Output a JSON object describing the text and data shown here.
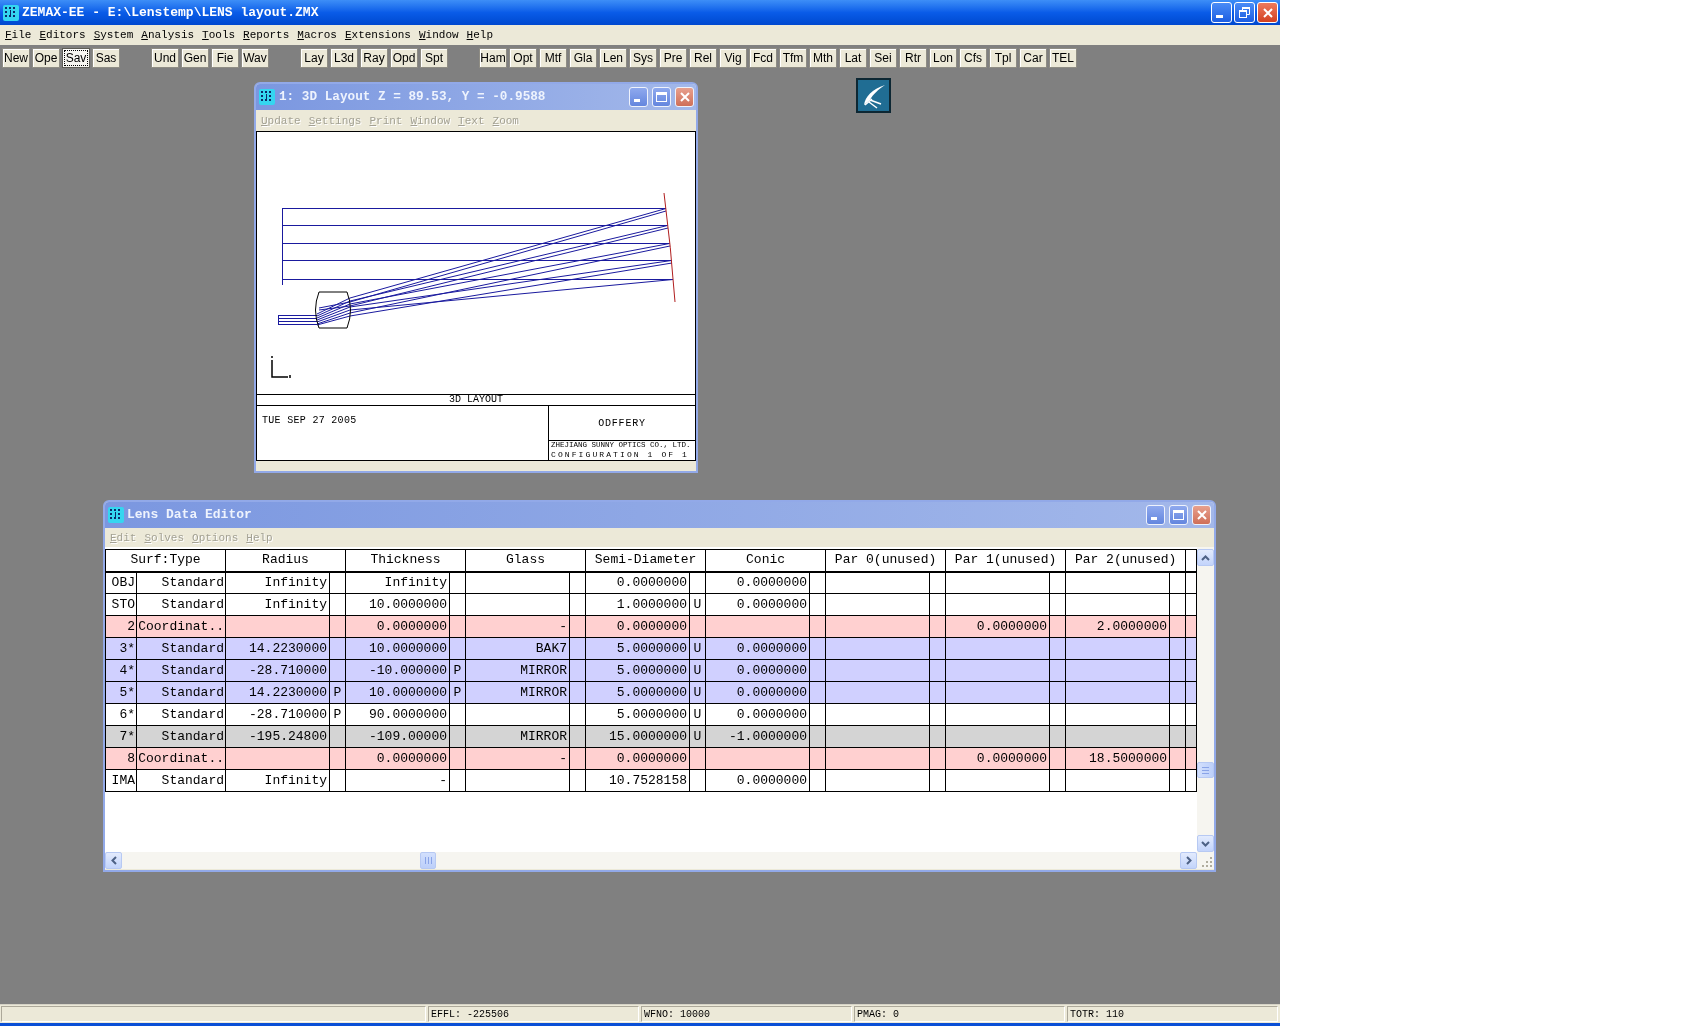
{
  "window": {
    "title": "ZEMAX-EE - E:\\Lenstemp\\LENS layout.ZMX"
  },
  "menu": [
    {
      "label": "File",
      "disabled": false
    },
    {
      "label": "Editors",
      "disabled": false
    },
    {
      "label": "System",
      "disabled": false
    },
    {
      "label": "Analysis",
      "disabled": false
    },
    {
      "label": "Tools",
      "disabled": false
    },
    {
      "label": "Reports",
      "disabled": false
    },
    {
      "label": "Macros",
      "disabled": false
    },
    {
      "label": "Extensions",
      "disabled": false
    },
    {
      "label": "Window",
      "disabled": false
    },
    {
      "label": "Help",
      "disabled": false
    }
  ],
  "toolbar": [
    [
      {
        "label": "New",
        "focused": false
      },
      {
        "label": "Ope",
        "focused": false
      },
      {
        "label": "Sav",
        "focused": true
      },
      {
        "label": "Sas",
        "focused": false
      }
    ],
    [
      {
        "label": "Und",
        "focused": false
      },
      {
        "label": "Gen",
        "focused": false
      },
      {
        "label": "Fie",
        "focused": false
      },
      {
        "label": "Wav",
        "focused": false
      }
    ],
    [
      {
        "label": "Lay",
        "focused": false
      },
      {
        "label": "L3d",
        "focused": false
      },
      {
        "label": "Ray",
        "focused": false
      },
      {
        "label": "Opd",
        "focused": false
      },
      {
        "label": "Spt",
        "focused": false
      }
    ],
    [
      {
        "label": "Ham",
        "focused": false
      },
      {
        "label": "Opt",
        "focused": false
      },
      {
        "label": "Mtf",
        "focused": false
      },
      {
        "label": "Gla",
        "focused": false
      },
      {
        "label": "Len",
        "focused": false
      },
      {
        "label": "Sys",
        "focused": false
      },
      {
        "label": "Pre",
        "focused": false
      },
      {
        "label": "Rel",
        "focused": false
      },
      {
        "label": "Vig",
        "focused": false
      },
      {
        "label": "Fcd",
        "focused": false
      },
      {
        "label": "Tfm",
        "focused": false
      },
      {
        "label": "Mth",
        "focused": false
      },
      {
        "label": "Lat",
        "focused": false
      },
      {
        "label": "Sei",
        "focused": false
      },
      {
        "label": "Rtr",
        "focused": false
      },
      {
        "label": "Lon",
        "focused": false
      },
      {
        "label": "Cfs",
        "focused": false
      },
      {
        "label": "Tpl",
        "focused": false
      },
      {
        "label": "Car",
        "focused": false
      },
      {
        "label": "TEL",
        "focused": false
      }
    ]
  ],
  "layout_window": {
    "title": "1: 3D Layout Z = 89.53, Y = -0.9588",
    "menu": [
      {
        "label": "Update",
        "disabled": true
      },
      {
        "label": "Settings",
        "disabled": true
      },
      {
        "label": "Print",
        "disabled": true
      },
      {
        "label": "Window",
        "disabled": true
      },
      {
        "label": "Text",
        "disabled": true
      },
      {
        "label": "Zoom",
        "disabled": true
      }
    ],
    "plot": {
      "title": "3D LAYOUT",
      "date": "TUE SEP 27 2005",
      "designer": "ODFFERY",
      "company": "ZHEJIANG SUNNY OPTICS CO., LTD.",
      "configuration": "CONFIGURATION 1 OF 1"
    }
  },
  "lens_data_editor": {
    "title": "Lens Data Editor",
    "menu": [
      {
        "label": "Edit",
        "disabled": true
      },
      {
        "label": "Solves",
        "disabled": true
      },
      {
        "label": "Options",
        "disabled": true
      },
      {
        "label": "Help",
        "disabled": true
      }
    ],
    "columns": [
      "Surf:Type",
      "Radius",
      "Thickness",
      "Glass",
      "Semi-Diameter",
      "Conic",
      "Par 0(unused)",
      "Par 1(unused)",
      "Par 2(unused)"
    ],
    "rows": [
      {
        "surface": "OBJ",
        "type": "Standard",
        "radius": "Infinity",
        "thickness": "Infinity",
        "semi_diameter": "0.0000000",
        "conic": "0.0000000",
        "color": "#ffffff"
      },
      {
        "surface": "STO",
        "type": "Standard",
        "radius": "Infinity",
        "thickness": "10.0000000",
        "semi_diameter": "1.0000000",
        "semi_diameter_solve": "U",
        "conic": "0.0000000",
        "color": "#ffffff"
      },
      {
        "surface": "2",
        "type": "Coordinat..",
        "thickness": "0.0000000",
        "glass": "-",
        "semi_diameter": "0.0000000",
        "par_1": "0.0000000",
        "par_2": "2.0000000",
        "color": "#ffd0d0"
      },
      {
        "surface": "3*",
        "type": "Standard",
        "radius": "14.2230000",
        "thickness": "10.0000000",
        "glass": "BAK7",
        "semi_diameter": "5.0000000",
        "semi_diameter_solve": "U",
        "conic": "0.0000000",
        "color": "#d0d0ff"
      },
      {
        "surface": "4*",
        "type": "Standard",
        "radius": "-28.710000",
        "thickness": "-10.000000",
        "thickness_solve": "P",
        "glass": "MIRROR",
        "semi_diameter": "5.0000000",
        "semi_diameter_solve": "U",
        "conic": "0.0000000",
        "color": "#d0d0ff"
      },
      {
        "surface": "5*",
        "type": "Standard",
        "radius": "14.2230000",
        "radius_solve": "P",
        "thickness": "10.0000000",
        "thickness_solve": "P",
        "glass": "MIRROR",
        "semi_diameter": "5.0000000",
        "semi_diameter_solve": "U",
        "conic": "0.0000000",
        "color": "#d0d0ff"
      },
      {
        "surface": "6*",
        "type": "Standard",
        "radius": "-28.710000",
        "radius_solve": "P",
        "thickness": "90.0000000",
        "semi_diameter": "5.0000000",
        "semi_diameter_solve": "U",
        "conic": "0.0000000",
        "color": "#ffffff"
      },
      {
        "surface": "7*",
        "type": "Standard",
        "radius": "-195.24800",
        "thickness": "-109.00000",
        "glass": "MIRROR",
        "semi_diameter": "15.0000000",
        "semi_diameter_solve": "U",
        "conic": "-1.0000000",
        "color": "#d4d4d4"
      },
      {
        "surface": "8",
        "type": "Coordinat..",
        "thickness": "0.0000000",
        "glass": "-",
        "semi_diameter": "0.0000000",
        "par_1": "0.0000000",
        "par_2": "18.5000000",
        "color": "#ffd0d0"
      },
      {
        "surface": "IMA",
        "type": "Standard",
        "radius": "Infinity",
        "thickness": "-",
        "semi_diameter": "10.7528158",
        "conic": "0.0000000",
        "color": "#ffffff"
      }
    ]
  },
  "status_bar": [
    "EFFL: -225506",
    "WFNO: 10000",
    "PMAG: 0",
    "TOTR: 110"
  ]
}
